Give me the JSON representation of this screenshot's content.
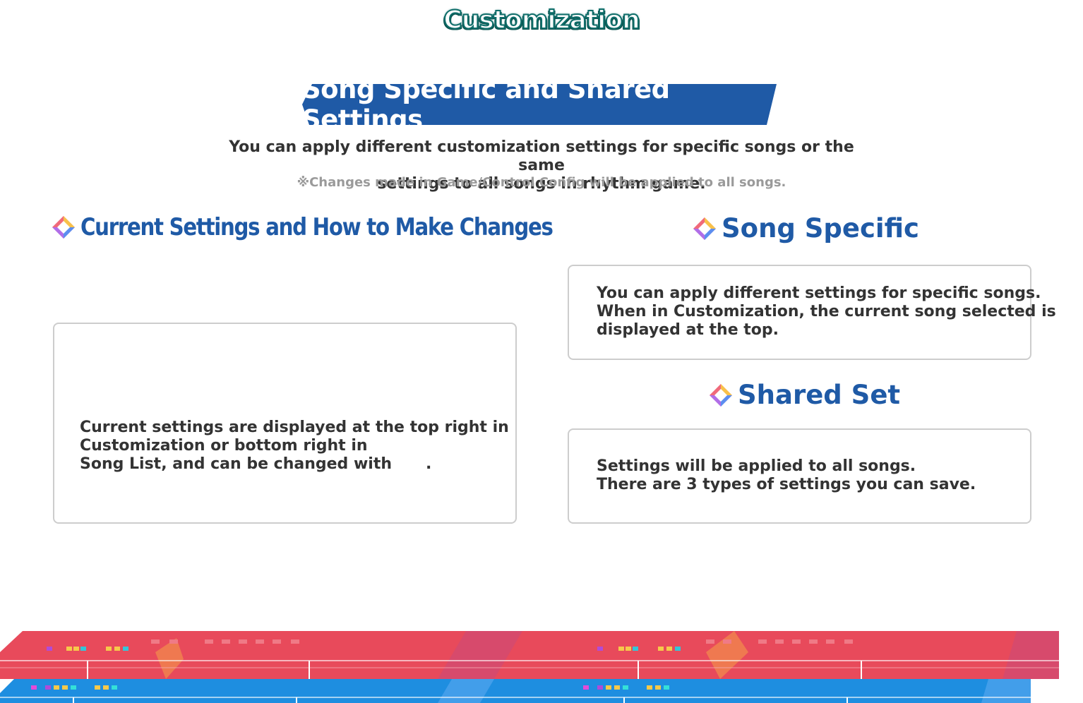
{
  "page_title": "Customization",
  "banner_title": "Song Specific and Shared Settings",
  "intro": {
    "line1": "You can apply different customization settings for specific songs or the same",
    "line2": "settings to all songs in rhythm game.",
    "note": "※Changes made in Game/Control Config will be applied to all songs."
  },
  "sections": {
    "current": {
      "heading": "Current Settings and How to Make Changes",
      "line1": "Current settings are displayed at the top right in",
      "line2": "Customization or bottom right in",
      "line3": "Song List, and can be changed with",
      "line3_end": "."
    },
    "song_specific": {
      "heading": "Song Specific",
      "line1": "You can apply different settings for specific songs.",
      "line2": "When in Customization, the current song selected is",
      "line3": "displayed at the top."
    },
    "shared_set": {
      "heading": "Shared Set",
      "line1": "Settings will be applied to all songs.",
      "line2": "There are 3 types of settings you can save."
    }
  },
  "icons": {
    "section_icon": "diamond-icon"
  },
  "colors": {
    "heading_blue": "#1f5aa6",
    "title_teal": "#0f6e6a",
    "strip_red": "#e84a5b",
    "strip_blue": "#1e8ee0"
  }
}
